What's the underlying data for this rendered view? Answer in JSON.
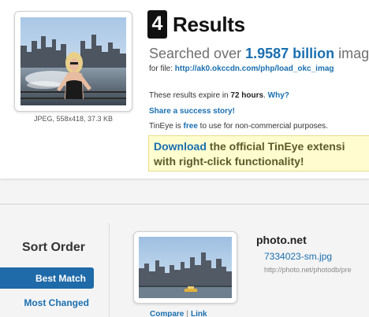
{
  "query": {
    "caption": "JPEG, 558x418, 37.3 KB"
  },
  "results": {
    "count": "4",
    "heading": "Results",
    "searched_prefix": "Searched over ",
    "searched_count": "1.9587 billion",
    "searched_suffix": " imag",
    "file_prefix": "for file: ",
    "file_url": "http://ak0.okccdn.com/php/load_okc_imag",
    "expire_prefix": "These results expire in ",
    "expire_time": "72 hours",
    "expire_suffix": ". ",
    "why_link": "Why?",
    "share_link": "Share a success story!",
    "free_prefix": "TinEye is ",
    "free_link": "free",
    "free_suffix": " to use for non-commercial purposes.",
    "promo_link": "Download",
    "promo_text_1": " the official TinEye extensi",
    "promo_text_2": "with right-click functionality!"
  },
  "sort": {
    "title": "Sort Order",
    "active": "Best Match",
    "other": "Most Changed"
  },
  "match": {
    "domain": "photo.net",
    "file": "7334023-sm.jpg",
    "url": "http://photo.net/photodb/pre",
    "compare": "Compare",
    "link": "Link",
    "sep": "|"
  }
}
